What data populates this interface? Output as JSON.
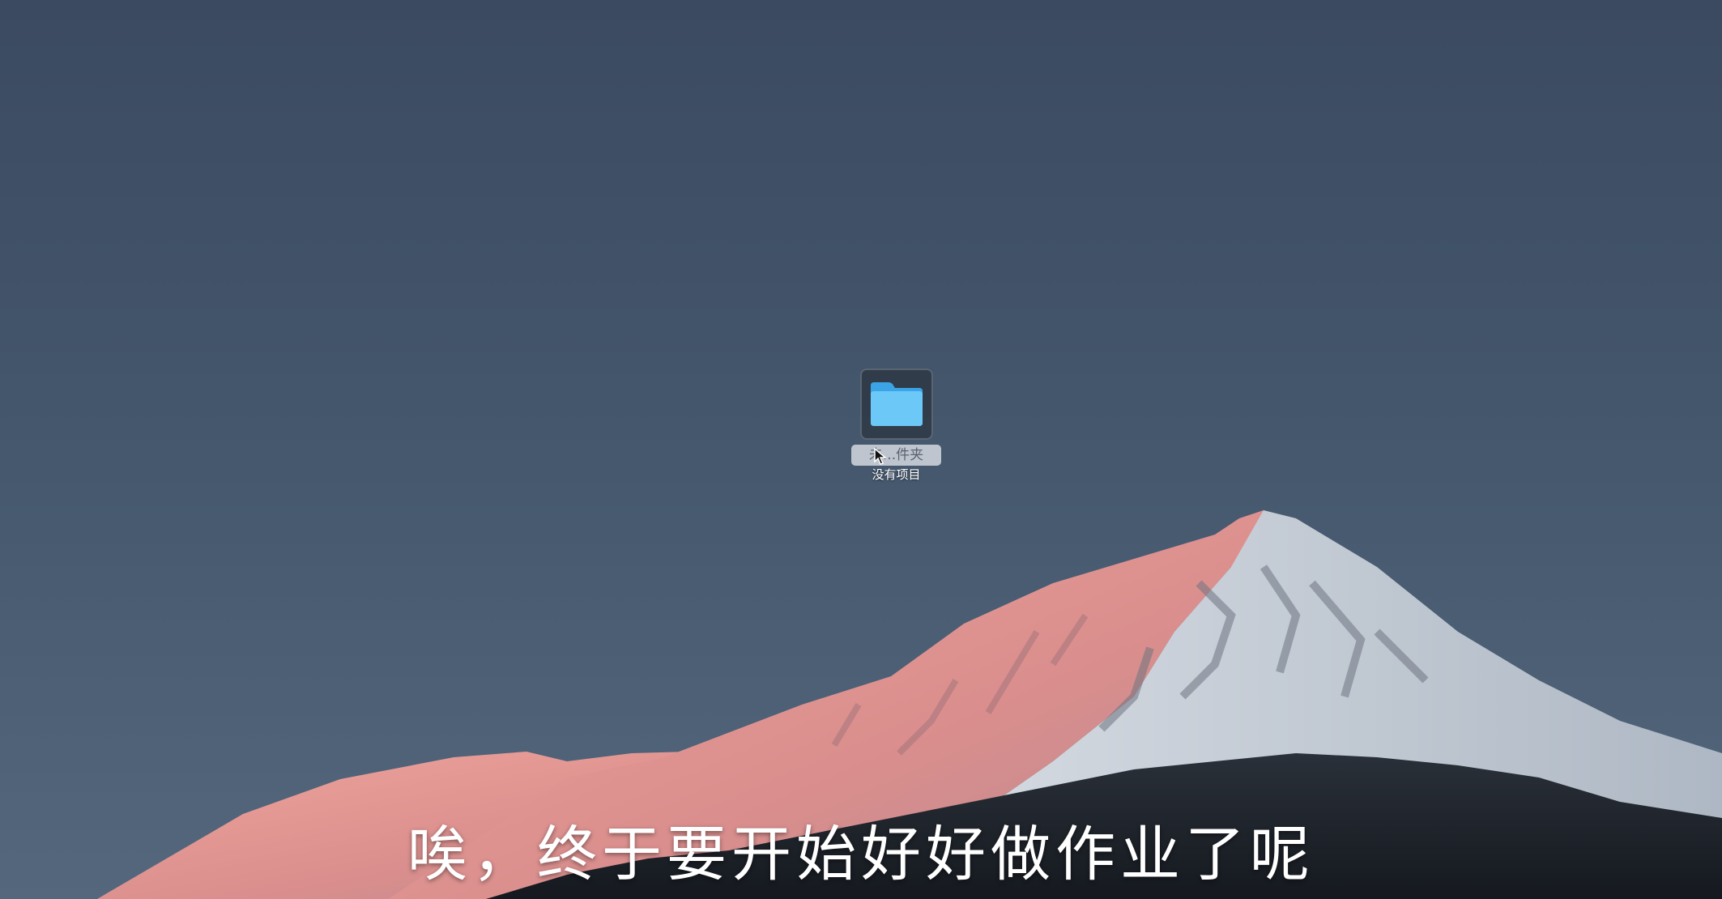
{
  "desktop": {
    "folder": {
      "icon": "folder-icon",
      "name": "未...件夹",
      "subtitle": "没有项目"
    }
  },
  "caption": {
    "text": "唉，终于要开始好好做作业了呢"
  },
  "colors": {
    "sky_top": "#3c4c62",
    "sky_bottom": "#52657c",
    "folder_blue": "#5fc0f5",
    "alpenglow": "#e89a94",
    "snow": "#e6ebf1",
    "forest": "#1c2129"
  }
}
